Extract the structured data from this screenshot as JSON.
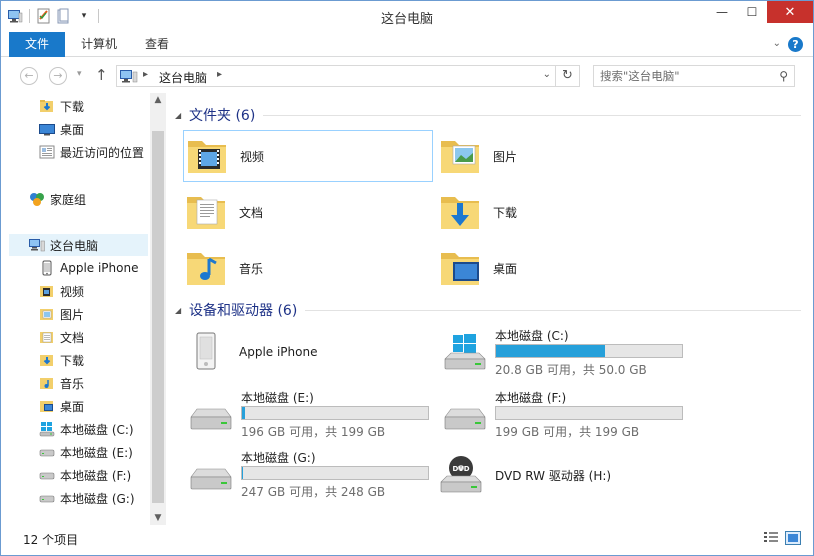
{
  "window": {
    "title": "这台电脑",
    "minimize_glyph": "—",
    "maximize_glyph": "☐",
    "close_glyph": "✕"
  },
  "ribbon": {
    "tabs": [
      "文件",
      "计算机",
      "查看"
    ],
    "help_glyph": "?"
  },
  "address": {
    "location": "这台电脑",
    "search_placeholder": "搜索\"这台电脑\""
  },
  "nav": {
    "quick_access": [
      {
        "label": "下载",
        "icon": "downloads-folder-icon"
      },
      {
        "label": "桌面",
        "icon": "desktop-icon"
      },
      {
        "label": "最近访问的位置",
        "icon": "recent-places-icon"
      }
    ],
    "homegroup": {
      "label": "家庭组",
      "icon": "homegroup-icon"
    },
    "this_pc": {
      "label": "这台电脑",
      "icon": "computer-icon"
    },
    "pc_children": [
      {
        "label": "Apple iPhone",
        "icon": "phone-icon"
      },
      {
        "label": "视频",
        "icon": "videos-folder-icon"
      },
      {
        "label": "图片",
        "icon": "pictures-folder-icon"
      },
      {
        "label": "文档",
        "icon": "documents-folder-icon"
      },
      {
        "label": "下载",
        "icon": "downloads-folder-icon"
      },
      {
        "label": "音乐",
        "icon": "music-folder-icon"
      },
      {
        "label": "桌面",
        "icon": "desktop-folder-icon"
      },
      {
        "label": "本地磁盘 (C:)",
        "icon": "windows-drive-icon"
      },
      {
        "label": "本地磁盘 (E:)",
        "icon": "drive-icon"
      },
      {
        "label": "本地磁盘 (F:)",
        "icon": "drive-icon"
      },
      {
        "label": "本地磁盘 (G:)",
        "icon": "drive-icon"
      }
    ]
  },
  "folders_group": {
    "title": "文件夹 (6)",
    "items": [
      {
        "label": "视频",
        "icon": "videos-folder-icon"
      },
      {
        "label": "图片",
        "icon": "pictures-folder-icon"
      },
      {
        "label": "文档",
        "icon": "documents-folder-icon"
      },
      {
        "label": "下载",
        "icon": "downloads-folder-icon"
      },
      {
        "label": "音乐",
        "icon": "music-folder-icon"
      },
      {
        "label": "桌面",
        "icon": "desktop-folder-icon"
      }
    ]
  },
  "devices_group": {
    "title": "设备和驱动器 (6)",
    "items": [
      {
        "name": "Apple iPhone",
        "icon": "iphone-device-icon"
      },
      {
        "name": "本地磁盘 (C:)",
        "free": "20.8 GB 可用，共 50.0 GB",
        "used_fraction": 0.584,
        "icon": "windows-drive-icon"
      },
      {
        "name": "本地磁盘 (E:)",
        "free": "196 GB 可用，共 199 GB",
        "used_fraction": 0.015,
        "icon": "hard-drive-icon"
      },
      {
        "name": "本地磁盘 (F:)",
        "free": "199 GB 可用，共 199 GB",
        "used_fraction": 0.0,
        "icon": "hard-drive-icon"
      },
      {
        "name": "本地磁盘 (G:)",
        "free": "247 GB 可用，共 248 GB",
        "used_fraction": 0.004,
        "icon": "hard-drive-icon"
      },
      {
        "name": "DVD RW 驱动器 (H:)",
        "icon": "dvd-drive-icon"
      }
    ]
  },
  "status": {
    "item_count": "12 个项目"
  },
  "colors": {
    "accent": "#1979ca",
    "drive_fill": "#26a0da",
    "group_title": "#1e3287"
  }
}
